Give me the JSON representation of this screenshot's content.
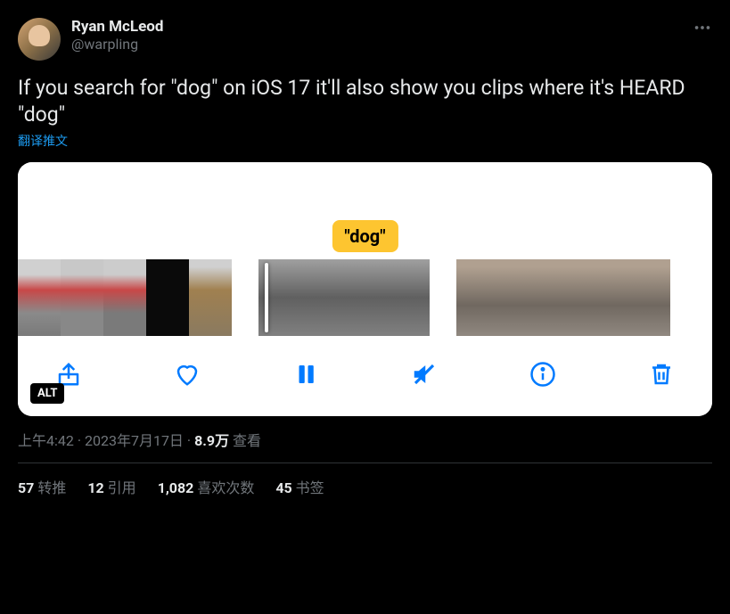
{
  "user": {
    "display_name": "Ryan McLeod",
    "handle": "@warpling"
  },
  "tweet_text": "If you search for \"dog\" on iOS 17 it'll also show you clips where it's HEARD \"dog\"",
  "translate_label": "翻译推文",
  "media": {
    "tag_text": "\"dog\"",
    "alt_label": "ALT",
    "controls": {
      "share": "share",
      "like": "like",
      "pause": "pause",
      "mute": "mute",
      "info": "info",
      "delete": "delete"
    }
  },
  "meta": {
    "time": "上午4:42",
    "date": "2023年7月17日",
    "views_count": "8.9万",
    "views_label": "查看"
  },
  "stats": {
    "retweets_count": "57",
    "retweets_label": "转推",
    "quotes_count": "12",
    "quotes_label": "引用",
    "likes_count": "1,082",
    "likes_label": "喜欢次数",
    "bookmarks_count": "45",
    "bookmarks_label": "书签"
  },
  "colors": {
    "accent": "#1d9bf0",
    "tag_bg": "#fdc530",
    "ios_blue": "#007aff"
  }
}
